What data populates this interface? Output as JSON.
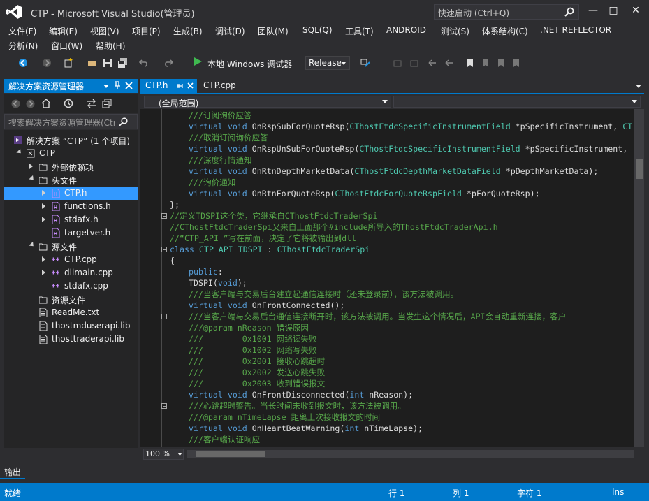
{
  "window": {
    "title": "CTP - Microsoft Visual Studio(管理员)",
    "quick_launch_placeholder": "快速启动 (Ctrl+Q)",
    "minimize": "—",
    "maximize": "□",
    "close": "✕"
  },
  "menu": [
    "文件(F)",
    "编辑(E)",
    "视图(V)",
    "项目(P)",
    "生成(B)",
    "调试(D)",
    "团队(M)",
    "SQL(Q)",
    "工具(T)",
    "ANDROID",
    "测试(S)",
    "体系结构(C)",
    ".NET REFLECTOR",
    "分析(N)",
    "窗口(W)",
    "帮助(H)"
  ],
  "toolbar": {
    "debugger_label": "本地 Windows 调试器",
    "configuration": "Release"
  },
  "solution_explorer": {
    "title": "解决方案资源管理器",
    "search_placeholder": "搜索解决方案资源管理器(Ctrl+;)",
    "items": [
      {
        "label": "解决方案 “CTP” (1 个项目)",
        "level": 0,
        "state": "none",
        "icon": "solution-icon"
      },
      {
        "label": "CTP",
        "level": 1,
        "state": "expanded",
        "icon": "project-icon"
      },
      {
        "label": "外部依赖项",
        "level": 2,
        "state": "collapsed",
        "icon": "external-deps-icon"
      },
      {
        "label": "头文件",
        "level": 2,
        "state": "expanded",
        "icon": "folder-icon"
      },
      {
        "label": "CTP.h",
        "level": 3,
        "state": "collapsed",
        "icon": "header-file-icon",
        "selected": true
      },
      {
        "label": "functions.h",
        "level": 3,
        "state": "collapsed",
        "icon": "header-file-icon"
      },
      {
        "label": "stdafx.h",
        "level": 3,
        "state": "collapsed",
        "icon": "header-file-icon"
      },
      {
        "label": "targetver.h",
        "level": 3,
        "state": "none",
        "icon": "header-file-icon"
      },
      {
        "label": "源文件",
        "level": 2,
        "state": "expanded",
        "icon": "folder-icon"
      },
      {
        "label": "CTP.cpp",
        "level": 3,
        "state": "collapsed",
        "icon": "cpp-file-icon"
      },
      {
        "label": "dllmain.cpp",
        "level": 3,
        "state": "collapsed",
        "icon": "cpp-file-icon"
      },
      {
        "label": "stdafx.cpp",
        "level": 3,
        "state": "none",
        "icon": "cpp-file-icon"
      },
      {
        "label": "资源文件",
        "level": 2,
        "state": "none",
        "icon": "folder-icon"
      },
      {
        "label": "ReadMe.txt",
        "level": 2,
        "state": "none",
        "icon": "text-file-icon"
      },
      {
        "label": "thostmduserapi.lib",
        "level": 2,
        "state": "none",
        "icon": "lib-file-icon"
      },
      {
        "label": "thosttraderapi.lib",
        "level": 2,
        "state": "none",
        "icon": "lib-file-icon"
      }
    ]
  },
  "editor": {
    "tabs": [
      {
        "label": "CTP.h",
        "active": true
      },
      {
        "label": "CTP.cpp",
        "active": false
      }
    ],
    "scope": "(全局范围)",
    "zoom": "100 %",
    "lines": [
      {
        "indent": 2,
        "fold": false,
        "parts": [
          {
            "c": "c",
            "t": "///订阅询价应答"
          }
        ]
      },
      {
        "indent": 2,
        "fold": false,
        "parts": [
          {
            "c": "k",
            "t": "virtual void "
          },
          {
            "c": "",
            "t": "OnRspSubForQuoteRsp("
          },
          {
            "c": "t",
            "t": "CThostFtdcSpecificInstrumentField"
          },
          {
            "c": "",
            "t": " *pSpecificInstrument, "
          },
          {
            "c": "t",
            "t": "CT"
          }
        ]
      },
      {
        "indent": 2,
        "fold": false,
        "parts": [
          {
            "c": "c",
            "t": "///取消订阅询价应答"
          }
        ]
      },
      {
        "indent": 2,
        "fold": false,
        "parts": [
          {
            "c": "k",
            "t": "virtual void "
          },
          {
            "c": "",
            "t": "OnRspUnSubForQuoteRsp("
          },
          {
            "c": "t",
            "t": "CThostFtdcSpecificInstrumentField"
          },
          {
            "c": "",
            "t": " *pSpecificInstrument,"
          }
        ]
      },
      {
        "indent": 2,
        "fold": false,
        "parts": [
          {
            "c": "c",
            "t": "///深度行情通知"
          }
        ]
      },
      {
        "indent": 2,
        "fold": false,
        "parts": [
          {
            "c": "k",
            "t": "virtual void "
          },
          {
            "c": "",
            "t": "OnRtnDepthMarketData("
          },
          {
            "c": "t",
            "t": "CThostFtdcDepthMarketDataField"
          },
          {
            "c": "",
            "t": " *pDepthMarketData);"
          }
        ]
      },
      {
        "indent": 2,
        "fold": false,
        "parts": [
          {
            "c": "c",
            "t": "///询价通知"
          }
        ]
      },
      {
        "indent": 2,
        "fold": false,
        "parts": [
          {
            "c": "k",
            "t": "virtual void "
          },
          {
            "c": "",
            "t": "OnRtnForQuoteRsp("
          },
          {
            "c": "t",
            "t": "CThostFtdcForQuoteRspField"
          },
          {
            "c": "",
            "t": " *pForQuoteRsp);"
          }
        ]
      },
      {
        "indent": 0,
        "fold": false,
        "parts": [
          {
            "c": "",
            "t": "};"
          }
        ]
      },
      {
        "indent": 0,
        "fold": true,
        "parts": [
          {
            "c": "c",
            "t": "//定义TDSPI这个类，它继承自CThostFtdcTraderSpi"
          }
        ]
      },
      {
        "indent": 0,
        "fold": false,
        "parts": [
          {
            "c": "c",
            "t": "//CThostFtdcTraderSpi又来自上面那个#include所导入的ThostFtdcTraderApi.h"
          }
        ]
      },
      {
        "indent": 0,
        "fold": false,
        "parts": [
          {
            "c": "c",
            "t": "//“CTP_API ”写在前面，决定了它将被输出到dll"
          }
        ]
      },
      {
        "indent": 0,
        "fold": true,
        "parts": [
          {
            "c": "k",
            "t": "class "
          },
          {
            "c": "t",
            "t": "CTP_API TDSPI"
          },
          {
            "c": "",
            "t": " : "
          },
          {
            "c": "t",
            "t": "CThostFtdcTraderSpi"
          }
        ]
      },
      {
        "indent": 0,
        "fold": false,
        "parts": [
          {
            "c": "",
            "t": "{"
          }
        ]
      },
      {
        "indent": 2,
        "fold": false,
        "parts": [
          {
            "c": "k",
            "t": "public"
          },
          {
            "c": "",
            "t": ":"
          }
        ]
      },
      {
        "indent": 2,
        "fold": false,
        "parts": [
          {
            "c": "",
            "t": "TDSPI("
          },
          {
            "c": "k",
            "t": "void"
          },
          {
            "c": "",
            "t": ");"
          }
        ]
      },
      {
        "indent": 2,
        "fold": false,
        "parts": [
          {
            "c": "c",
            "t": "///当客户端与交易后台建立起通信连接时（还未登录前），该方法被调用。"
          }
        ]
      },
      {
        "indent": 2,
        "fold": false,
        "parts": [
          {
            "c": "k",
            "t": "virtual void "
          },
          {
            "c": "",
            "t": "OnFrontConnected();"
          }
        ]
      },
      {
        "indent": 2,
        "fold": true,
        "parts": [
          {
            "c": "c",
            "t": "///当客户端与交易后台通信连接断开时，该方法被调用。当发生这个情况后，API会自动重新连接，客户"
          }
        ]
      },
      {
        "indent": 2,
        "fold": false,
        "parts": [
          {
            "c": "c",
            "t": "///@param nReason 错误原因"
          }
        ]
      },
      {
        "indent": 2,
        "fold": false,
        "parts": [
          {
            "c": "c",
            "t": "///        0x1001 网络读失败"
          }
        ]
      },
      {
        "indent": 2,
        "fold": false,
        "parts": [
          {
            "c": "c",
            "t": "///        0x1002 网络写失败"
          }
        ]
      },
      {
        "indent": 2,
        "fold": false,
        "parts": [
          {
            "c": "c",
            "t": "///        0x2001 接收心跳超时"
          }
        ]
      },
      {
        "indent": 2,
        "fold": false,
        "parts": [
          {
            "c": "c",
            "t": "///        0x2002 发送心跳失败"
          }
        ]
      },
      {
        "indent": 2,
        "fold": false,
        "parts": [
          {
            "c": "c",
            "t": "///        0x2003 收到错误报文"
          }
        ]
      },
      {
        "indent": 2,
        "fold": false,
        "parts": [
          {
            "c": "k",
            "t": "virtual void "
          },
          {
            "c": "",
            "t": "OnFrontDisconnected("
          },
          {
            "c": "k",
            "t": "int"
          },
          {
            "c": "",
            "t": " nReason);"
          }
        ]
      },
      {
        "indent": 2,
        "fold": true,
        "parts": [
          {
            "c": "c",
            "t": "///心跳超时警告。当长时间未收到报文时，该方法被调用。"
          }
        ]
      },
      {
        "indent": 2,
        "fold": false,
        "parts": [
          {
            "c": "c",
            "t": "///@param nTimeLapse 距离上次接收报文的时间"
          }
        ]
      },
      {
        "indent": 2,
        "fold": false,
        "parts": [
          {
            "c": "k",
            "t": "virtual void "
          },
          {
            "c": "",
            "t": "OnHeartBeatWarning("
          },
          {
            "c": "k",
            "t": "int"
          },
          {
            "c": "",
            "t": " nTimeLapse);"
          }
        ]
      },
      {
        "indent": 2,
        "fold": false,
        "parts": [
          {
            "c": "c",
            "t": "///客户端认证响应"
          }
        ]
      }
    ]
  },
  "output_tab": "输出",
  "status": {
    "ready": "就绪",
    "line": "行 1",
    "col": "列 1",
    "char": "字符 1",
    "mode": "Ins"
  },
  "colors": {
    "accent": "#007acc",
    "selection": "#3399ff",
    "comment": "#57a64a",
    "keyword": "#569cd6",
    "type": "#4ec9b0"
  }
}
